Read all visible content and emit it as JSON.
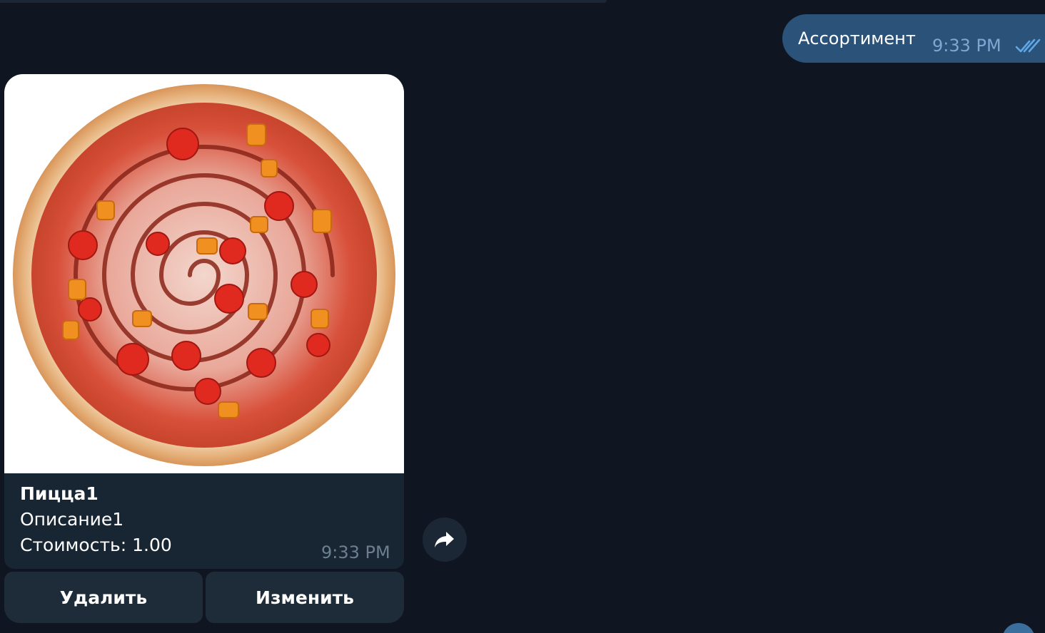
{
  "outgoing_message": {
    "text": "Ассортимент",
    "time": "9:33 PM",
    "status_icon": "double-check-icon"
  },
  "incoming_message": {
    "photo": "pizza-photo",
    "caption": {
      "title": "Пицца1",
      "description": "Описание1",
      "price": "Стоимость: 1.00"
    },
    "time": "9:33 PM"
  },
  "inline_keyboard": {
    "delete_label": "Удалить",
    "edit_label": "Изменить"
  },
  "icons": {
    "forward": "forward-arrow-icon",
    "scroll_down": "scroll-down-button"
  },
  "colors": {
    "background": "#0f1621",
    "outgoing_bubble": "#2b5278",
    "incoming_bubble": "#182533",
    "button": "#1e2c3a",
    "accent": "#3a6e9c"
  }
}
